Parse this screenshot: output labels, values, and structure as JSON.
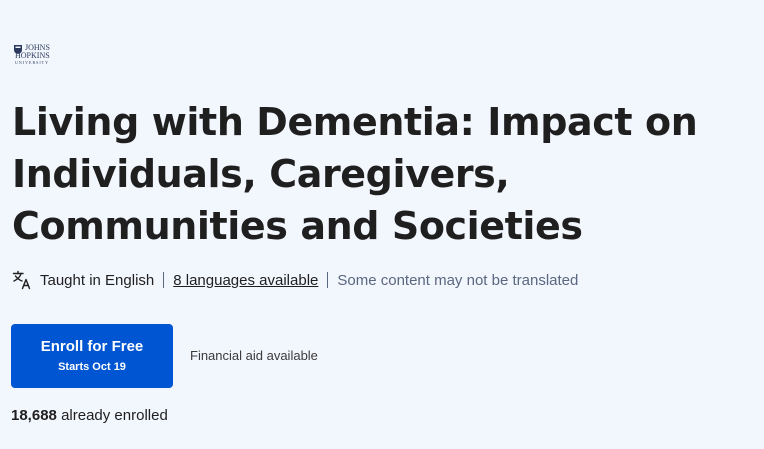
{
  "logo": {
    "line1": "JOHNS",
    "line2": "HOPKINS",
    "line3": "UNIVERSITY"
  },
  "course": {
    "title": "Living with Dementia: Impact on Individuals, Caregivers, Communities and Societies"
  },
  "language": {
    "icon": "translate-icon",
    "taught_in": "Taught in English",
    "languages_link": "8 languages available",
    "note": "Some content may not be translated"
  },
  "enroll": {
    "button_label": "Enroll for Free",
    "start_date": "Starts Oct 19",
    "financial_aid": "Financial aid available",
    "enrolled_count": "18,688",
    "enrolled_suffix": "already enrolled"
  },
  "colors": {
    "background": "#f2f6fd",
    "primary": "#0056d2",
    "text": "#1f1f1f"
  }
}
